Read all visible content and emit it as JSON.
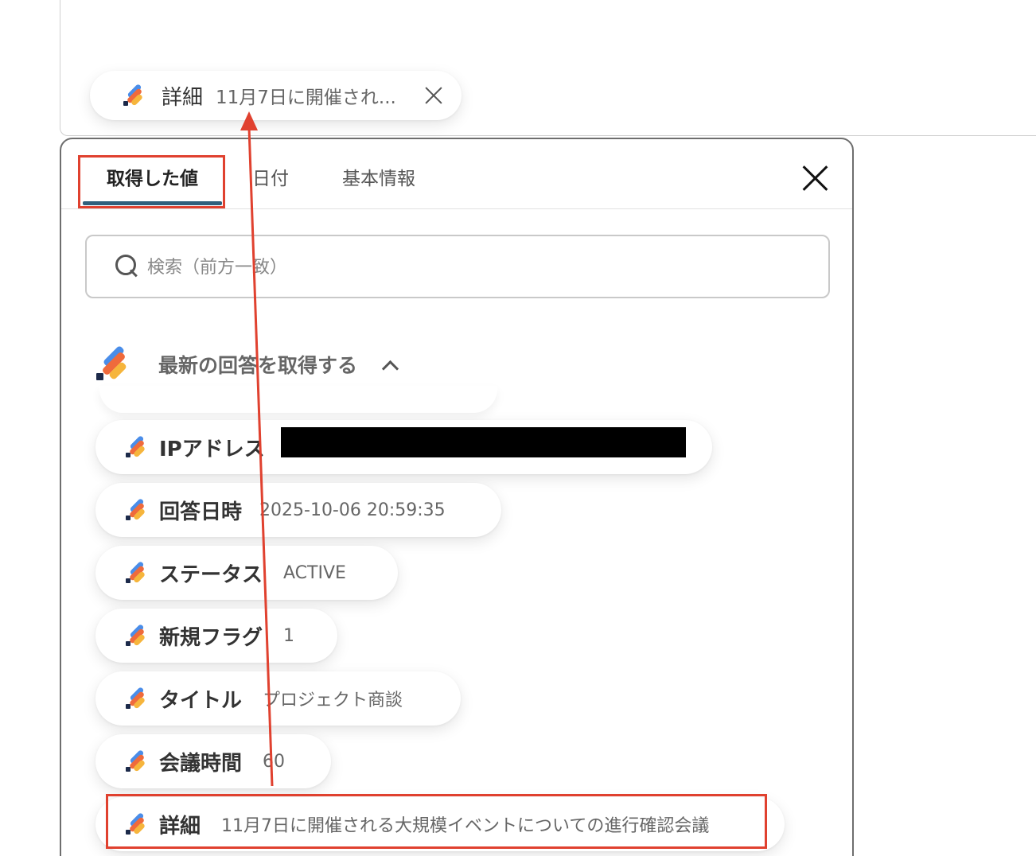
{
  "top_chip": {
    "label": "詳細",
    "value": "11月7日に開催され..."
  },
  "panel": {
    "tabs": [
      {
        "label": "取得した値",
        "active": true
      },
      {
        "label": "日付",
        "active": false
      },
      {
        "label": "基本情報",
        "active": false
      }
    ],
    "search": {
      "placeholder": "検索（前方一致）",
      "value": ""
    },
    "section": {
      "title": "最新の回答を取得する",
      "expanded": true
    },
    "items": [
      {
        "label": "IPアドレス",
        "value": "",
        "redacted": true
      },
      {
        "label": "回答日時",
        "value": "2025-10-06 20:59:35"
      },
      {
        "label": "ステータス",
        "value": "ACTIVE"
      },
      {
        "label": "新規フラグ",
        "value": "1"
      },
      {
        "label": "タイトル",
        "value": "プロジェクト商談"
      },
      {
        "label": "会議時間",
        "value": "60"
      },
      {
        "label": "詳細",
        "value": "11月7日に開催される大規模イベントについての進行確認会議"
      }
    ]
  },
  "colors": {
    "highlight": "#e0412f",
    "tab_underline": "#2f5f7c",
    "logo_blue": "#4a8de9",
    "logo_orange": "#ef6a3c",
    "logo_yellow": "#f6b53c"
  }
}
